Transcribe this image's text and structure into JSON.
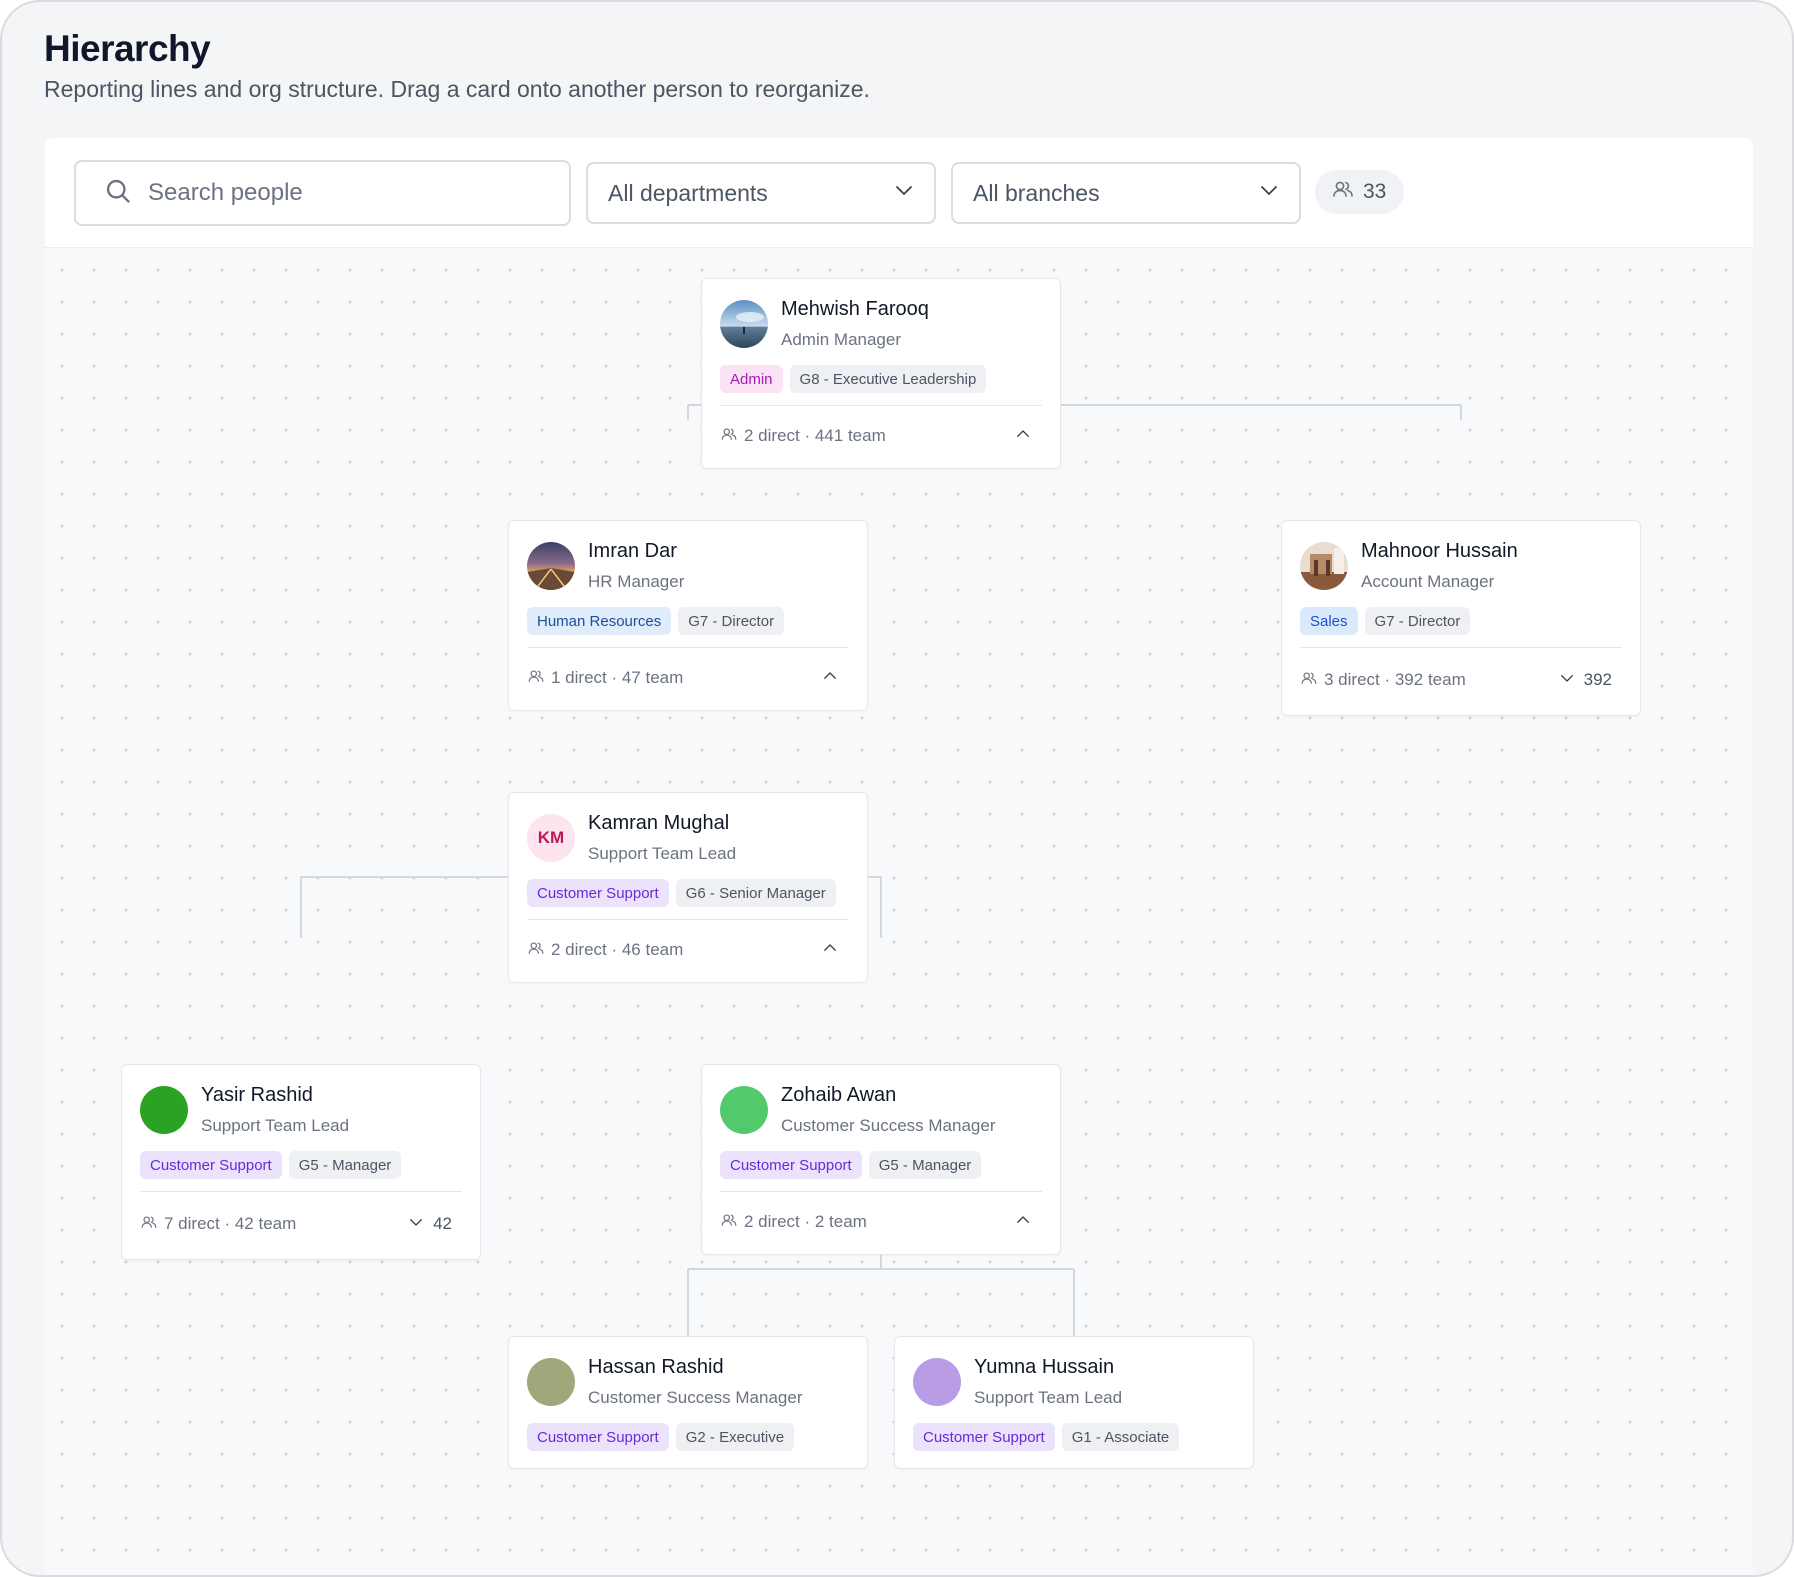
{
  "header": {
    "title": "Hierarchy",
    "subtitle": "Reporting lines and org structure. Drag a card onto another person to reorganize."
  },
  "toolbar": {
    "search_placeholder": "Search people",
    "department_filter": "All departments",
    "branch_filter": "All branches",
    "people_count": "33"
  },
  "colors": {
    "admin_tag_bg": "#fbe3f6",
    "admin_tag_text": "#a21caf",
    "hr_tag_bg": "#e0ecfa",
    "hr_tag_text": "#1e4f9c",
    "sales_tag_bg": "#dbeafb",
    "sales_tag_text": "#1d4ed8",
    "support_tag_bg": "#ebe2fb",
    "support_tag_text": "#6d28d9",
    "connector": "#d4d7dd"
  },
  "people": {
    "mehwish": {
      "name": "Mehwish Farooq",
      "role": "Admin Manager",
      "avatar": "photo-landscape",
      "department": "Admin",
      "grade": "G8 - Executive Leadership",
      "stats": "2 direct · 441 team",
      "toggle_icon": "chevron-up-icon"
    },
    "imran": {
      "name": "Imran Dar",
      "role": "HR Manager",
      "avatar": "photo-city-lights",
      "department": "Human Resources",
      "grade": "G7 - Director",
      "stats": "1 direct · 47 team",
      "toggle_icon": "chevron-up-icon"
    },
    "mahnoor": {
      "name": "Mahnoor Hussain",
      "role": "Account Manager",
      "avatar": "photo-interior",
      "department": "Sales",
      "grade": "G7 - Director",
      "stats": "3 direct · 392 team",
      "toggle_icon": "chevron-down-icon",
      "collapsed_count": "392"
    },
    "kamran": {
      "name": "Kamran Mughal",
      "role": "Support Team Lead",
      "initials": "KM",
      "department": "Customer Support",
      "grade": "G6 - Senior Manager",
      "stats": "2 direct · 46 team",
      "toggle_icon": "chevron-up-icon"
    },
    "yasir": {
      "name": "Yasir Rashid",
      "role": "Support Team Lead",
      "avatar_color": "#2aa324",
      "department": "Customer Support",
      "grade": "G5 - Manager",
      "stats": "7 direct · 42 team",
      "toggle_icon": "chevron-down-icon",
      "collapsed_count": "42"
    },
    "zohaib": {
      "name": "Zohaib Awan",
      "role": "Customer Success Manager",
      "avatar_color": "#52c96a",
      "department": "Customer Support",
      "grade": "G5 - Manager",
      "stats": "2 direct · 2 team",
      "toggle_icon": "chevron-up-icon"
    },
    "hassan": {
      "name": "Hassan Rashid",
      "role": "Customer Success Manager",
      "avatar_color": "#a0a77a",
      "department": "Customer Support",
      "grade": "G2 - Executive"
    },
    "yumna": {
      "name": "Yumna Hussain",
      "role": "Support Team Lead",
      "avatar_color": "#b89ce6",
      "department": "Customer Support",
      "grade": "G1 - Associate"
    }
  }
}
